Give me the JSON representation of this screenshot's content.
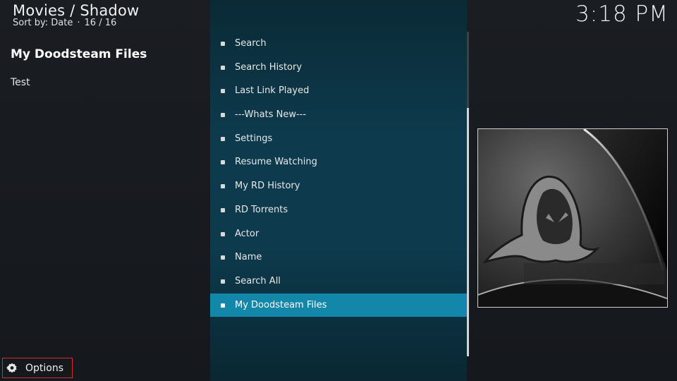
{
  "header": {
    "title": "Movies / Shadow",
    "sort_label": "Sort by: Date",
    "separator": "·",
    "position": "16 / 16",
    "clock": "3:18 PM"
  },
  "info": {
    "title": "My Doodsteam Files",
    "plot": "Test"
  },
  "menu": {
    "items": [
      {
        "label": "Search"
      },
      {
        "label": "Search History"
      },
      {
        "label": "Last Link Played"
      },
      {
        "label": "---Whats New---"
      },
      {
        "label": "Settings"
      },
      {
        "label": "Resume Watching"
      },
      {
        "label": "My RD History"
      },
      {
        "label": "RD Torrents"
      },
      {
        "label": "Actor"
      },
      {
        "label": "Name"
      },
      {
        "label": "Search All"
      },
      {
        "label": "My Doodsteam Files"
      }
    ],
    "selected_index": 11
  },
  "footer": {
    "options_label": "Options",
    "options_icon": "gear-icon"
  },
  "colors": {
    "accent": "#1287aa",
    "highlight_border": "#d42c2c"
  }
}
